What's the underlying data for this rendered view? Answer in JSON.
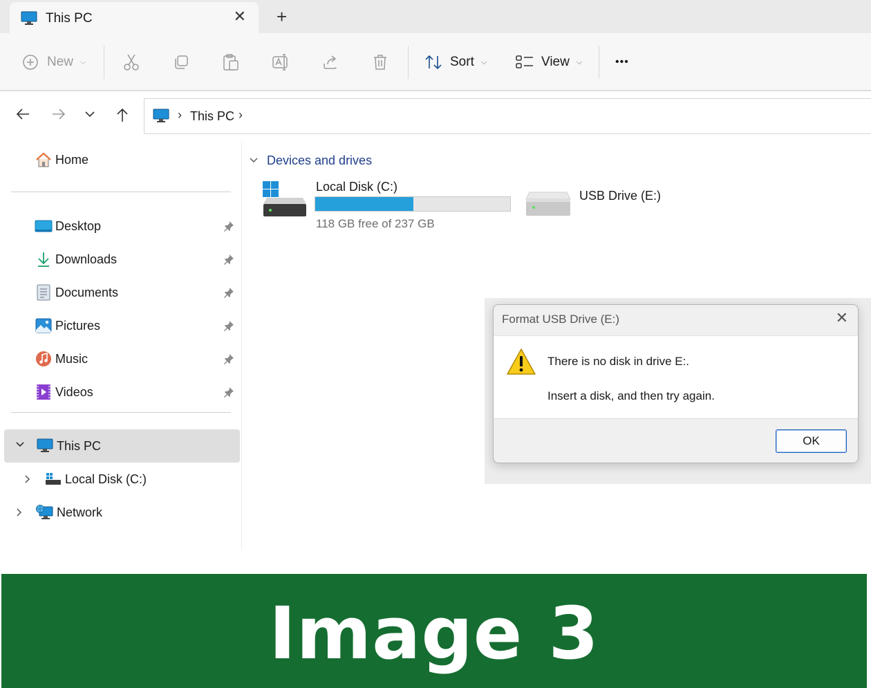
{
  "tab": {
    "title": "This PC",
    "close": "✕",
    "new_tab": "+"
  },
  "toolbar": {
    "new_label": "New",
    "sort_label": "Sort",
    "view_label": "View",
    "more_label": "•••"
  },
  "address": {
    "separator": "›",
    "location": "This PC"
  },
  "sidebar": {
    "home": "Home",
    "quick_access": [
      {
        "label": "Desktop"
      },
      {
        "label": "Downloads"
      },
      {
        "label": "Documents"
      },
      {
        "label": "Pictures"
      },
      {
        "label": "Music"
      },
      {
        "label": "Videos"
      }
    ],
    "this_pc": "This PC",
    "local_disk": "Local Disk (C:)",
    "network": "Network"
  },
  "main": {
    "group_header": "Devices and drives",
    "drives": [
      {
        "name": "Local Disk (C:)",
        "free_text": "118 GB free of 237 GB",
        "used_fraction": 0.502
      },
      {
        "name": "USB Drive (E:)"
      }
    ]
  },
  "dialog": {
    "title": "Format USB Drive (E:)",
    "close": "✕",
    "message_line1": "There is no disk in drive E:.",
    "message_line2": "Insert a disk, and then try again.",
    "ok_label": "OK"
  },
  "banner": {
    "text": "Image 3"
  },
  "colors": {
    "accent": "#26a0da",
    "banner_green": "#166d31",
    "link_blue": "#1f3f8c"
  }
}
